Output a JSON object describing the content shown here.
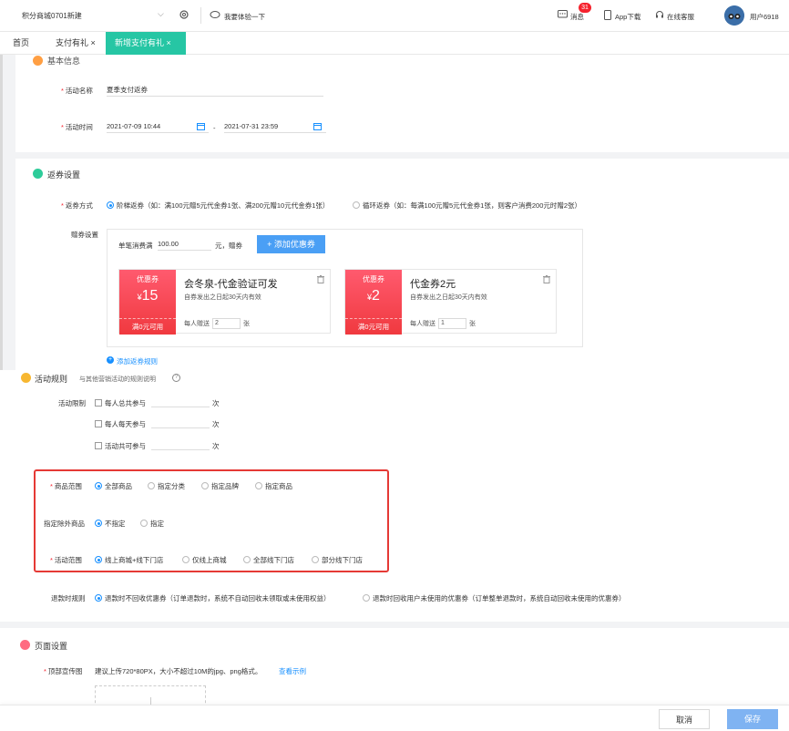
{
  "header": {
    "store_name": "积分商城0701新建",
    "try_label": "我要体验一下",
    "messages_label": "消息",
    "messages_badge": "31",
    "app_download_label": "App下载",
    "support_label": "在线客服",
    "user_name": "用户6918"
  },
  "tabs": [
    {
      "label": "首页"
    },
    {
      "label": "支付有礼 ×"
    },
    {
      "label": "新增支付有礼 ×"
    }
  ],
  "basic": {
    "title": "基本信息",
    "name_label": "活动名称",
    "name_value": "夏季支付返券",
    "time_label": "活动时间",
    "start_time": "2021-07-09 10:44",
    "separator": "-",
    "end_time": "2021-07-31 23:59"
  },
  "coupon_settings": {
    "title": "返券设置",
    "mode_label": "返券方式",
    "mode_options": [
      {
        "label": "阶梯返券（如：满100元赠5元代金券1张、满200元赠10元代金券1张）"
      },
      {
        "label": "循环返券（如：每满100元赠5元代金券1张，则客户消费200元时赠2张）"
      }
    ],
    "gift_label": "赠券设置",
    "threshold_prefix": "单笔消费满",
    "threshold_value": "100.00",
    "threshold_suffix": "元，赠券",
    "add_coupon_button": "+ 添加优惠券",
    "coupons": [
      {
        "tag": "优惠券",
        "currency": "¥",
        "amount": "15",
        "condition": "满0元可用",
        "name": "会冬泉-代金验证可发",
        "valid": "自券发出之日起30天内有效",
        "per_person_label": "每人赠送",
        "quantity": "2",
        "unit": "张"
      },
      {
        "tag": "优惠券",
        "currency": "¥",
        "amount": "2",
        "condition": "满0元可用",
        "name": "代金券2元",
        "valid": "自券发出之日起30天内有效",
        "per_person_label": "每人赠送",
        "quantity": "1",
        "unit": "张"
      }
    ],
    "add_rule_link": "添加返券规则"
  },
  "rules": {
    "title": "活动规则",
    "subtitle": "与其他营销活动的规则说明",
    "limit_label": "活动限制",
    "limits": [
      {
        "label": "每人总共参与",
        "unit": "次"
      },
      {
        "label": "每人每天参与",
        "unit": "次"
      },
      {
        "label": "活动共可参与",
        "unit": "次"
      }
    ],
    "goods_scope_label": "商品范围",
    "goods_scope_options": [
      {
        "label": "全部商品"
      },
      {
        "label": "指定分类"
      },
      {
        "label": "指定品牌"
      },
      {
        "label": "指定商品"
      }
    ],
    "exclude_label": "指定除外商品",
    "exclude_options": [
      {
        "label": "不指定"
      },
      {
        "label": "指定"
      }
    ],
    "scope_label": "活动范围",
    "scope_options": [
      {
        "label": "线上商城+线下门店"
      },
      {
        "label": "仅线上商城"
      },
      {
        "label": "全部线下门店"
      },
      {
        "label": "部分线下门店"
      }
    ],
    "refund_label": "退款时规则",
    "refund_options": [
      {
        "label": "退款时不回收优惠券（订单退款时，系统不自动回收未领取或未使用权益）"
      },
      {
        "label": "退款时回收用户未使用的优惠券（订单整单退款时，系统自动回收未使用的优惠券）"
      }
    ]
  },
  "page_settings": {
    "title": "页面设置",
    "banner_label": "顶部宣传图",
    "banner_hint": "建议上传720*80PX，大小不超过10M的jpg、png格式。",
    "example_link": "查看示例"
  },
  "footer": {
    "cancel_label": "取消",
    "save_label": "保存"
  },
  "colors": {
    "accent": "#26c6a4",
    "primary": "#1890ff",
    "danger": "#f5222d",
    "save_button": "#7fb3f2",
    "highlight_border": "#e53935"
  }
}
